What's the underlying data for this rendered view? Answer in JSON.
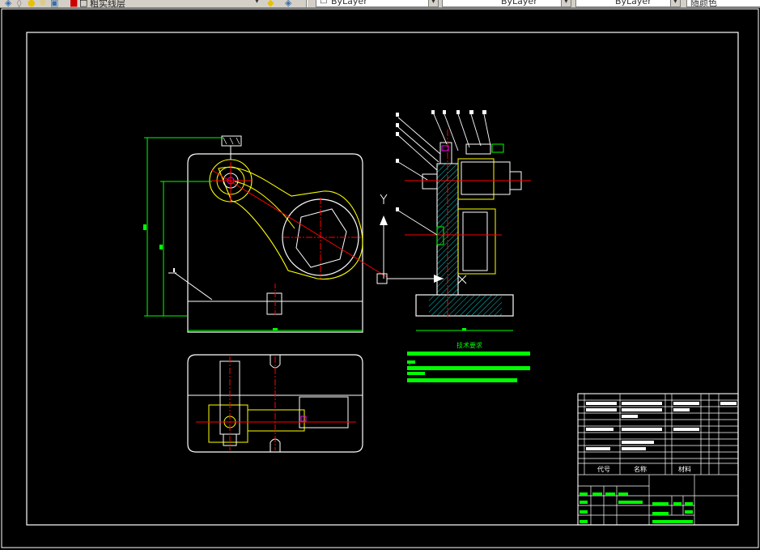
{
  "toolbar": {
    "layer_name": "粗实线层",
    "color_combo": "ByLayer",
    "linetype_combo": "ByLayer",
    "lineweight_combo": "ByLayer",
    "plotstyle_combo": "随颜色"
  },
  "drawing": {
    "tech_req_title": "技术要求",
    "tech_req_item_2": "2.",
    "title_block_headers": {
      "code": "代号",
      "name": "名称",
      "material": "材料"
    },
    "colors": {
      "background": "#000000",
      "outline": "#ffffff",
      "dimension": "#00ff00",
      "center_line": "#ff0000",
      "hidden": "#ffff00",
      "hatch": "#00ffff",
      "leader": "#ffffff",
      "highlight": "#ff00ff"
    }
  }
}
